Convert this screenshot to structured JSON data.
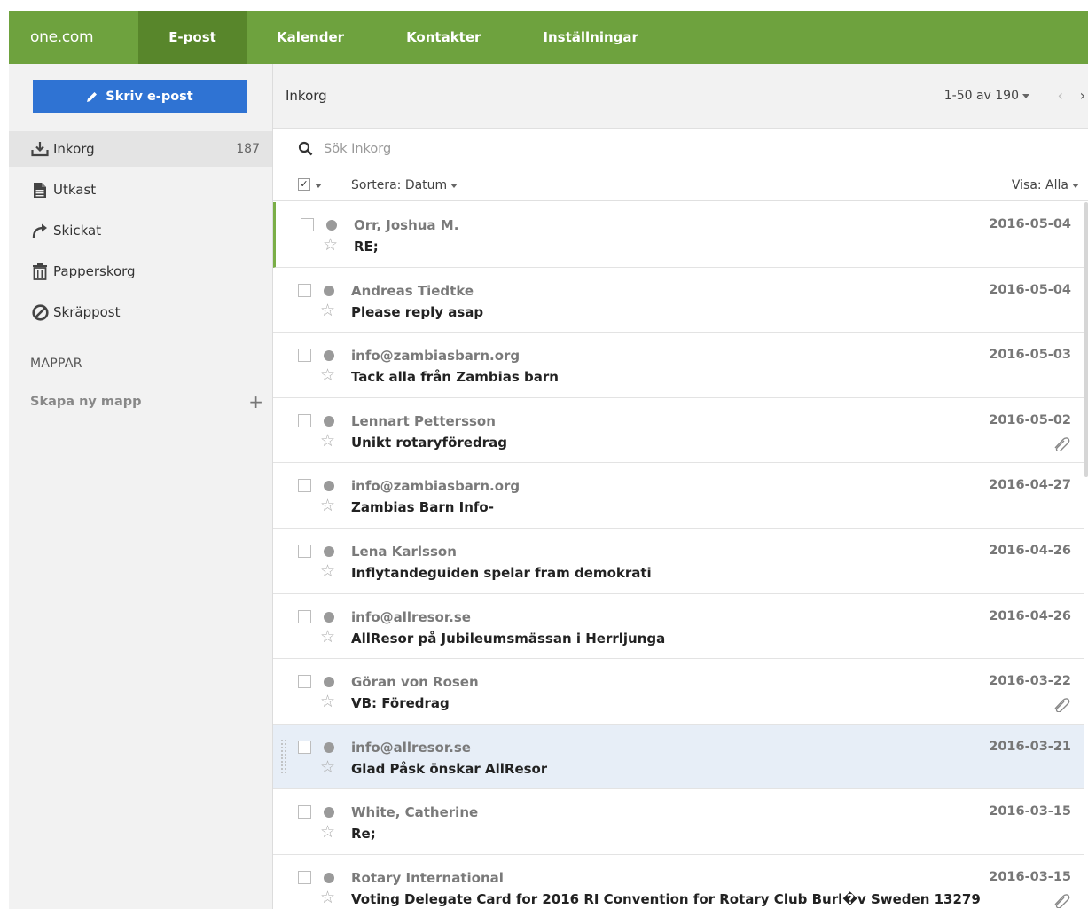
{
  "topnav": {
    "logo": "one.com",
    "items": [
      "E-post",
      "Kalender",
      "Kontakter",
      "Inställningar"
    ],
    "active": "E-post"
  },
  "sidebar": {
    "compose_label": "Skriv e-post",
    "folders": [
      {
        "label": "Inkorg",
        "count": "187",
        "icon": "inbox-download-icon"
      },
      {
        "label": "Utkast",
        "count": "",
        "icon": "document-icon"
      },
      {
        "label": "Skickat",
        "count": "",
        "icon": "send-arrow-icon"
      },
      {
        "label": "Papperskorg",
        "count": "",
        "icon": "trash-icon"
      },
      {
        "label": "Skräppost",
        "count": "",
        "icon": "block-icon"
      }
    ],
    "section_label": "MAPPAR",
    "new_folder_label": "Skapa ny mapp",
    "new_folder_plus": "+"
  },
  "toolbar": {
    "title": "Inkorg",
    "pager": "1-50 av 190",
    "prev": "‹",
    "next": "›"
  },
  "search": {
    "placeholder": "Sök Inkorg"
  },
  "sortbar": {
    "sort_label": "Sortera: Datum",
    "show_label": "Visa: Alla"
  },
  "emails": [
    {
      "sender": "Orr, Joshua M.",
      "subject": "RE;",
      "date": "2016-05-04",
      "attachment": false
    },
    {
      "sender": "Andreas Tiedtke",
      "subject": "Please reply asap",
      "date": "2016-05-04",
      "attachment": false
    },
    {
      "sender": "info@zambiasbarn.org",
      "subject": "Tack alla från Zambias barn",
      "date": "2016-05-03",
      "attachment": false
    },
    {
      "sender": "Lennart Pettersson",
      "subject": "Unikt rotaryföredrag",
      "date": "2016-05-02",
      "attachment": true
    },
    {
      "sender": "info@zambiasbarn.org",
      "subject": "Zambias Barn Info-",
      "date": "2016-04-27",
      "attachment": false
    },
    {
      "sender": "Lena Karlsson",
      "subject": "Inflytandeguiden spelar fram demokrati",
      "date": "2016-04-26",
      "attachment": false
    },
    {
      "sender": "info@allresor.se",
      "subject": "AllResor på Jubileumsmässan i Herrljunga",
      "date": "2016-04-26",
      "attachment": false
    },
    {
      "sender": "Göran von Rosen",
      "subject": "VB: Föredrag",
      "date": "2016-03-22",
      "attachment": true
    },
    {
      "sender": "info@allresor.se",
      "subject": "Glad Påsk önskar AllResor",
      "date": "2016-03-21",
      "attachment": false
    },
    {
      "sender": "White, Catherine",
      "subject": "Re;",
      "date": "2016-03-15",
      "attachment": false
    },
    {
      "sender": "Rotary International",
      "subject": "Voting Delegate Card for 2016 RI Convention for Rotary Club Burl�v Sweden 13279",
      "date": "2016-03-15",
      "attachment": true
    }
  ],
  "colors": {
    "topbar": "#6ea23e",
    "topbar_active": "#58862b",
    "compose": "#2f73d3",
    "row_hover": "#e7eef7",
    "selected_marker": "#7aae47"
  }
}
